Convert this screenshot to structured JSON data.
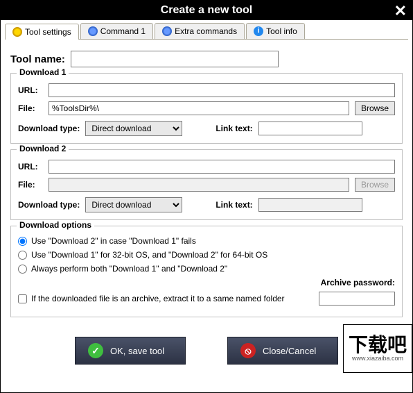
{
  "title": "Create a new tool",
  "tabs": {
    "tool_settings": "Tool settings",
    "command1": "Command 1",
    "extra_commands": "Extra commands",
    "tool_info": "Tool info"
  },
  "tool_name_label": "Tool name:",
  "tool_name_value": "",
  "download1": {
    "legend": "Download 1",
    "url_label": "URL:",
    "url_value": "",
    "file_label": "File:",
    "file_value": "%ToolsDir%\\",
    "browse": "Browse",
    "dtype_label": "Download type:",
    "dtype_value": "Direct download",
    "linktext_label": "Link text:",
    "linktext_value": ""
  },
  "download2": {
    "legend": "Download 2",
    "url_label": "URL:",
    "url_value": "",
    "file_label": "File:",
    "file_value": "",
    "browse": "Browse",
    "dtype_label": "Download type:",
    "dtype_value": "Direct download",
    "linktext_label": "Link text:",
    "linktext_value": ""
  },
  "options": {
    "legend": "Download options",
    "opt1": "Use \"Download 2\" in case \"Download 1\" fails",
    "opt2": "Use \"Download 1\" for 32-bit OS, and \"Download 2\" for 64-bit OS",
    "opt3": "Always perform both \"Download 1\" and \"Download 2\"",
    "archive_check": "If the downloaded file is an archive, extract it to a same named folder",
    "archive_pw_label": "Archive password:",
    "archive_pw_value": ""
  },
  "buttons": {
    "ok": "OK, save tool",
    "cancel": "Close/Cancel"
  },
  "watermark": {
    "top": "下载吧",
    "bottom": "www.xiazaiba.com"
  }
}
